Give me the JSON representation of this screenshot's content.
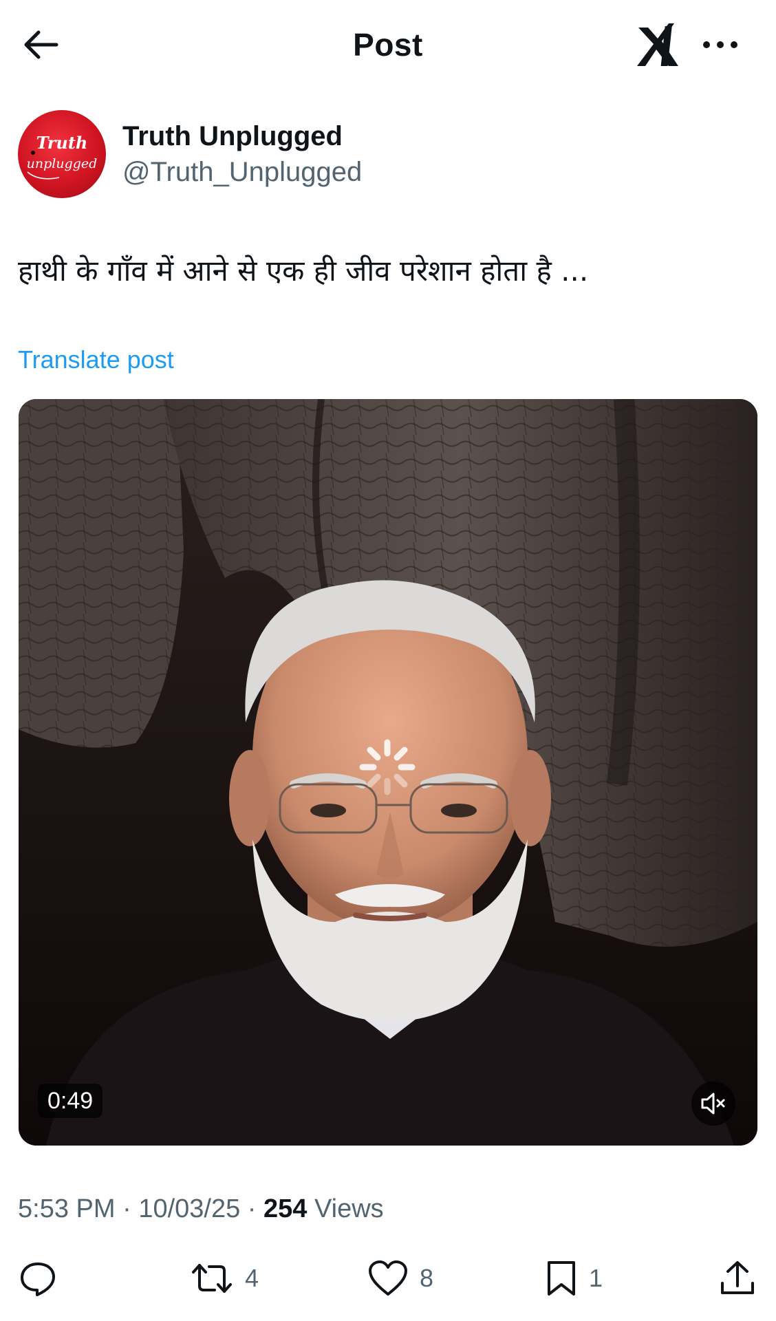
{
  "header": {
    "title": "Post"
  },
  "author": {
    "name": "Truth Unplugged",
    "handle": "@Truth_Unplugged"
  },
  "avatar": {
    "line1": "Truth",
    "line2": "unplugged"
  },
  "post": {
    "text": "हाथी के गाँव में आने से एक ही जीव परेशान होता है ...",
    "translate_label": "Translate post"
  },
  "media": {
    "duration": "0:49"
  },
  "meta": {
    "time": "5:53 PM",
    "separator": "·",
    "date": "10/03/25",
    "views_count": "254",
    "views_label": "Views"
  },
  "actions": {
    "reposts": "4",
    "likes": "8",
    "bookmarks": "1"
  },
  "colors": {
    "accent": "#1d9bf0",
    "text": "#0f1419",
    "secondary": "#536471",
    "avatar_red": "#d01422"
  },
  "icons": [
    "arrow-left-icon",
    "grok-icon",
    "more-icon",
    "speaker-muted-icon",
    "reply-icon",
    "repost-icon",
    "heart-icon",
    "bookmark-icon",
    "share-icon",
    "loading-spinner-icon"
  ]
}
